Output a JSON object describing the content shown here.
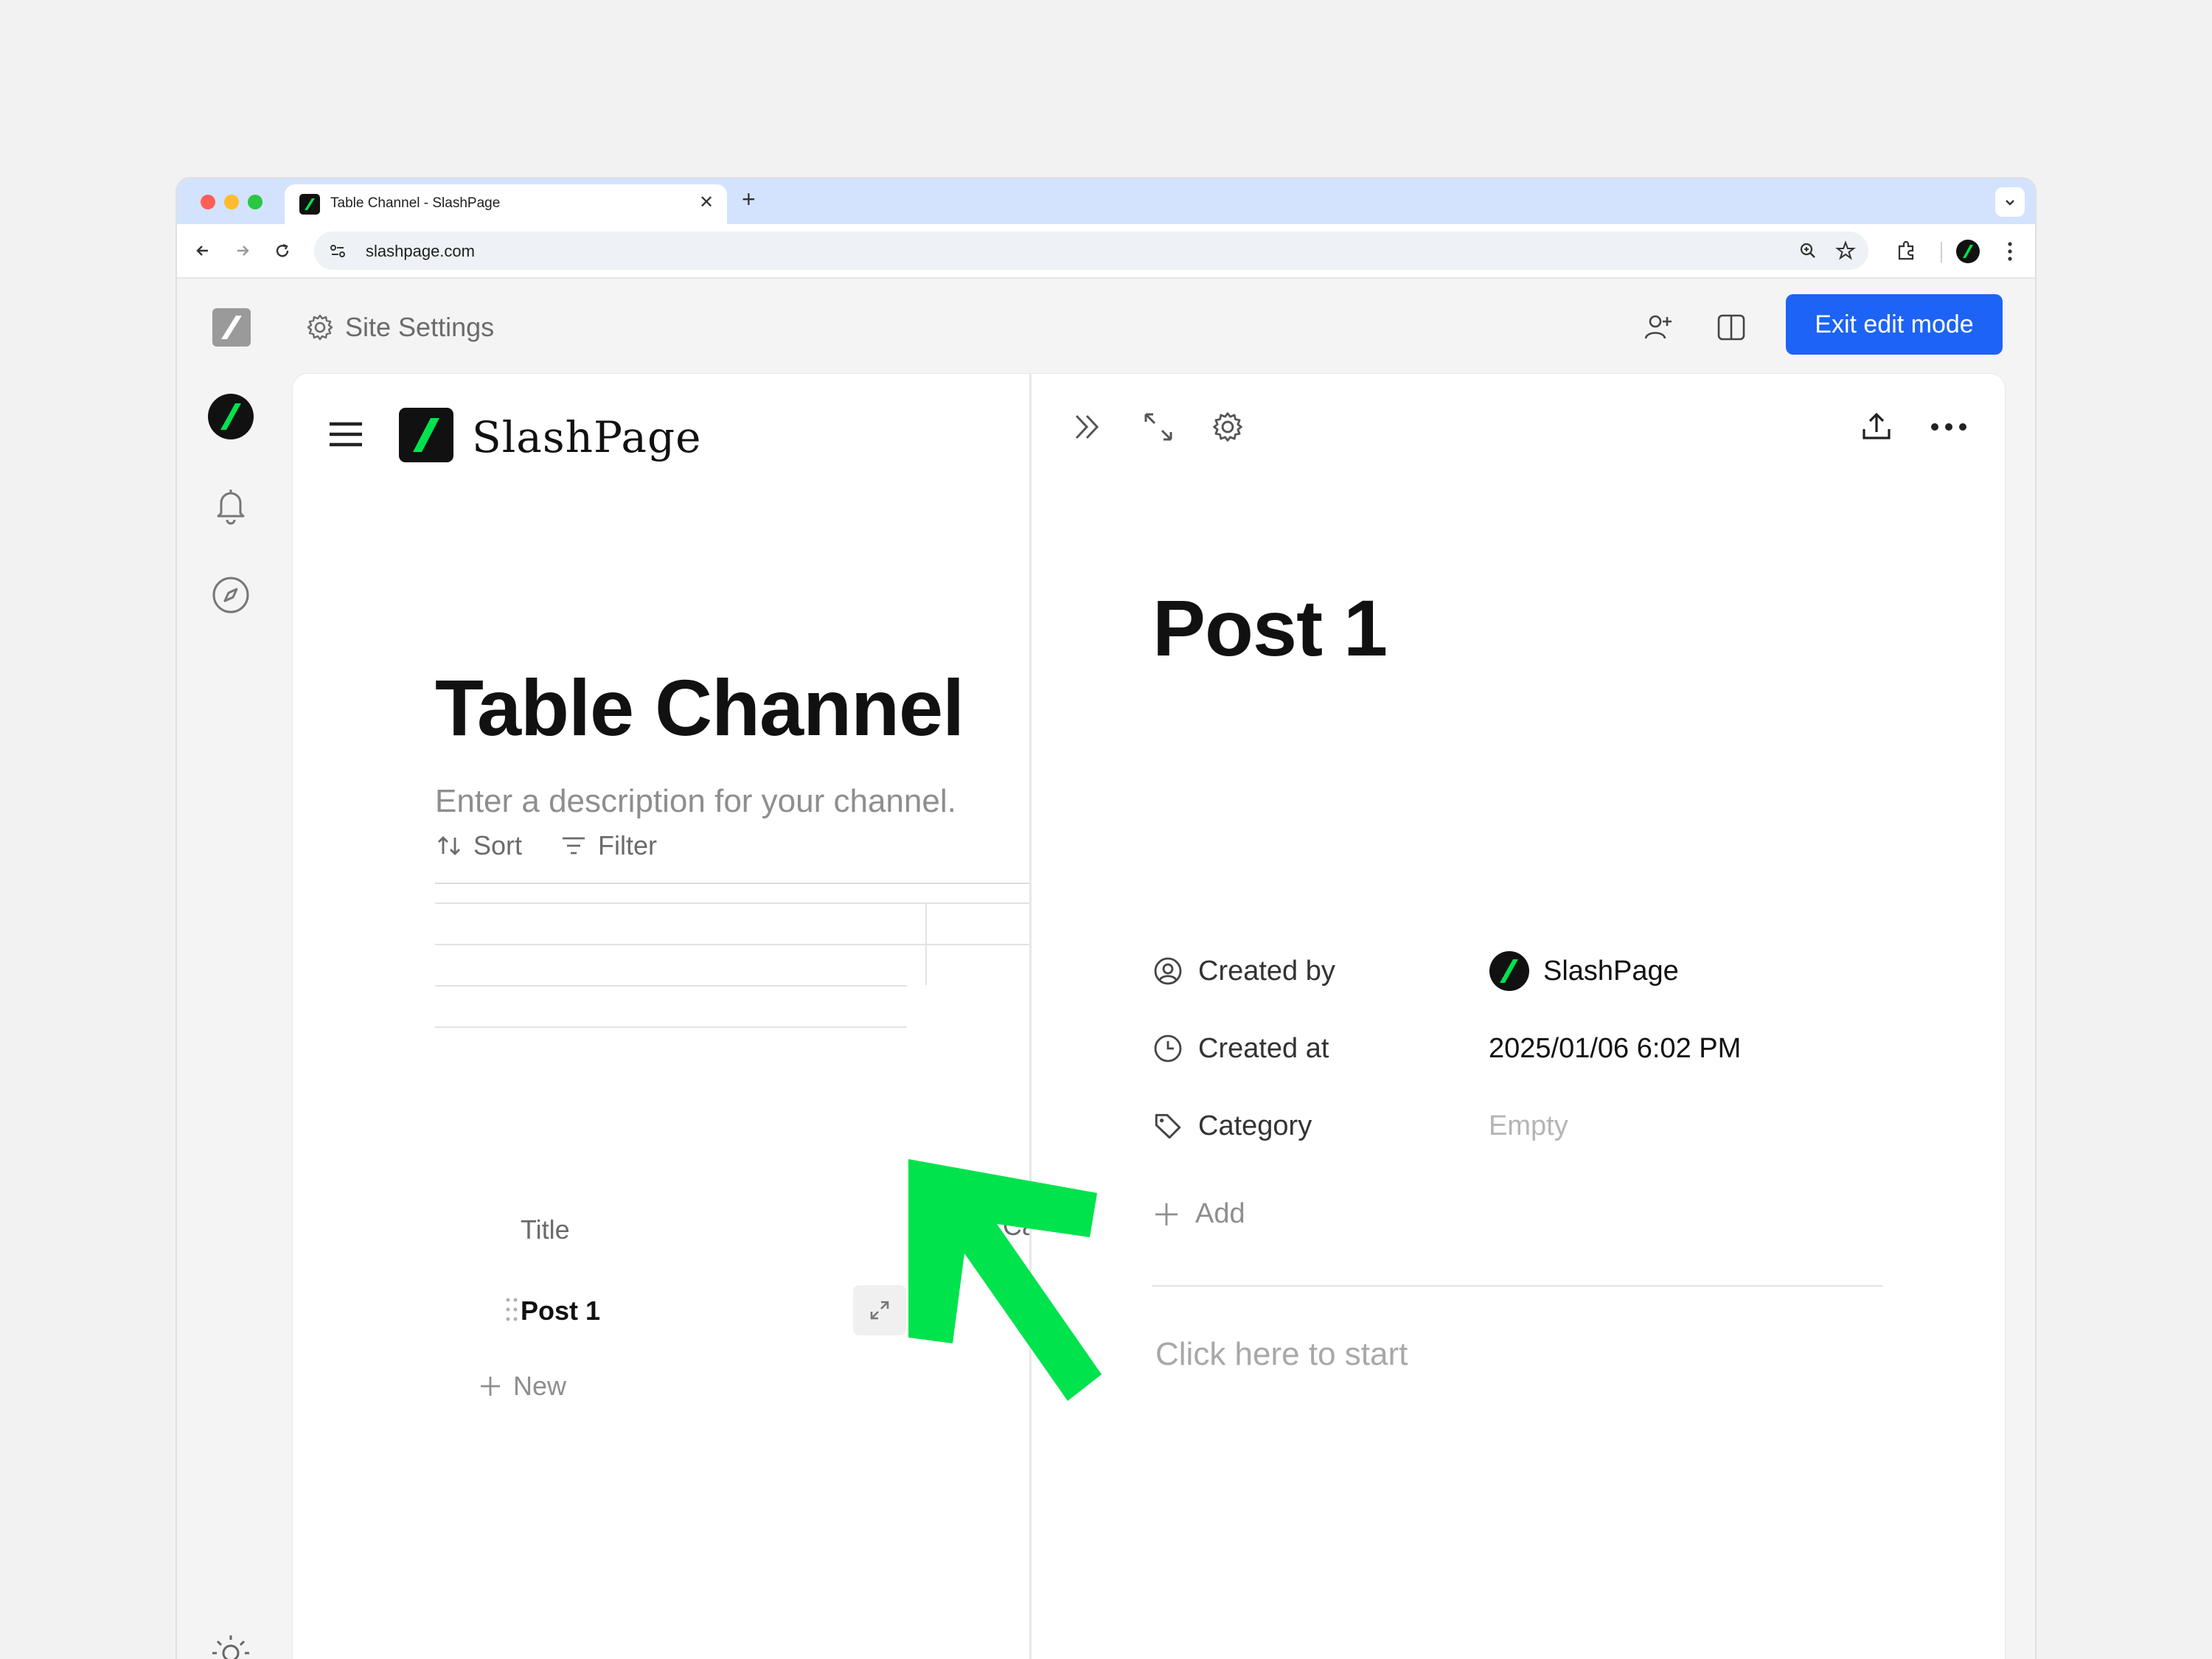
{
  "browser": {
    "tab_title": "Table Channel - SlashPage",
    "url": "slashpage.com",
    "icons": [
      "back-icon",
      "forward-icon",
      "reload-icon",
      "site-info-icon",
      "zoom-icon",
      "bookmark-star-icon",
      "extensions-icon",
      "profile-icon",
      "browser-menu-icon",
      "tab-close-icon",
      "new-tab-icon",
      "tab-search-icon"
    ]
  },
  "header": {
    "site_settings_label": "Site Settings",
    "exit_edit_label": "Exit edit mode"
  },
  "channel": {
    "brand_name": "SlashPage",
    "title": "Table Channel",
    "description_placeholder": "Enter a description for your channel.",
    "sort_label": "Sort",
    "filter_label": "Filter",
    "columns": [
      "Title",
      "Cat"
    ],
    "rows": [
      {
        "title": "Post 1"
      }
    ],
    "new_label": "New"
  },
  "post": {
    "title": "Post 1",
    "properties": [
      {
        "label": "Created by",
        "value": "SlashPage",
        "icon": "user-circle-icon"
      },
      {
        "label": "Created at",
        "value": "2025/01/06 6:02 PM",
        "icon": "clock-icon"
      },
      {
        "label": "Category",
        "value": "Empty",
        "icon": "tag-icon"
      }
    ],
    "add_label": "Add",
    "body_placeholder": "Click here to start"
  },
  "colors": {
    "accent_blue": "#1d63f5",
    "brand_green": "#00e34d",
    "tabstrip": "#d3e3fd"
  }
}
